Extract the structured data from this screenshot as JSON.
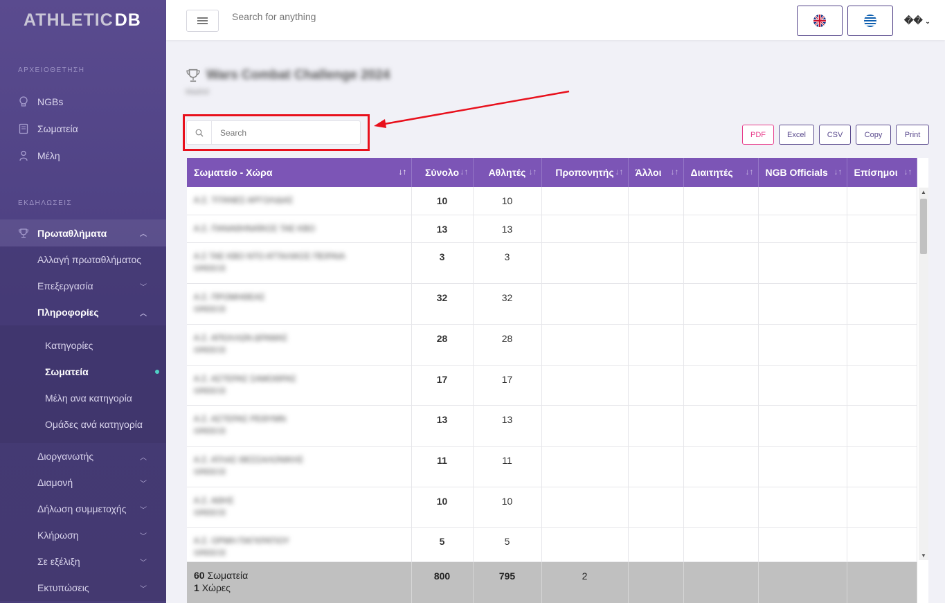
{
  "app": {
    "logo_main": "ATHLETIC",
    "logo_accent": "DB"
  },
  "sidebar": {
    "section_archive": "ΑΡΧΕΙΟΘΕΤΗΣΗ",
    "archive_items": [
      {
        "label": "NGBs",
        "icon": "lightbulb-icon"
      },
      {
        "label": "Σωματεία",
        "icon": "book-icon"
      },
      {
        "label": "Μέλη",
        "icon": "user-icon"
      }
    ],
    "section_events": "ΕΚΔΗΛΩΣΕΙΣ",
    "championships_label": "Πρωταθλήματα",
    "change_championship": "Αλλαγή πρωταθλήματος",
    "edit_label": "Επεξεργασία",
    "info_label": "Πληροφορίες",
    "info_items": [
      "Κατηγορίες",
      "Σωματεία",
      "Μέλη ανα κατηγορία",
      "Ομάδες ανά κατηγορία"
    ],
    "more_items": [
      "Διοργανωτής",
      "Διαμονή",
      "Δήλωση συμμετοχής",
      "Κλήρωση",
      "Σε εξέλιξη",
      "Εκτυπώσεις"
    ]
  },
  "topbar": {
    "search_placeholder": "Search for anything",
    "user_label": "��"
  },
  "page": {
    "title": "Wars Combat Challenge 2024",
    "subtitle": "Madrid"
  },
  "search": {
    "placeholder": "Search"
  },
  "export": {
    "pdf": "PDF",
    "excel": "Excel",
    "csv": "CSV",
    "copy": "Copy",
    "print": "Print"
  },
  "table": {
    "headers": [
      "Σωματείο - Χώρα",
      "Σύνολο",
      "Αθλητές",
      "Προπονητής",
      "Άλλοι",
      "Διαιτητές",
      "NGB Officials",
      "Επίσημοι"
    ],
    "rows": [
      {
        "club": "Α.Σ. ΤΙΤΑΝΕΣ ΑΡΓΟΛΙΔΑΣ",
        "country": "",
        "total": "10",
        "athletes": "10"
      },
      {
        "club": "Α.Σ. ΠΑΝΑΘΗΝΑΪΚΟΣ ΤΑΕ ΚΒΟ",
        "country": "",
        "total": "13",
        "athletes": "13"
      },
      {
        "club": "Α.Σ ΤΑΕ ΚΒΟ ΝΤΟ ΑΤΤΑΛΙΚΟΣ ΠΕΙΡΑΙΑ",
        "country": "GREECE",
        "total": "3",
        "athletes": "3"
      },
      {
        "club": "Α.Σ. ΠΡΟΜΗΘΕΑΣ",
        "country": "GREECE",
        "total": "32",
        "athletes": "32"
      },
      {
        "club": "Α.Σ. ΑΠΟΛΛΩΝ ΔΡΑΜΑΣ",
        "country": "GREECE",
        "total": "28",
        "athletes": "28"
      },
      {
        "club": "Α.Σ. ΑΣΤΕΡΑΣ ΣΑΜΟΘΡΑΣ",
        "country": "GREECE",
        "total": "17",
        "athletes": "17"
      },
      {
        "club": "Α.Σ. ΑΣΤΕΡΑΣ ΡΕΘΥΜΝ",
        "country": "GREECE",
        "total": "13",
        "athletes": "13"
      },
      {
        "club": "Α.Σ. ΑΤΛΑΣ ΘΕΣΣΑΛΟΝΙΚΗΣ",
        "country": "GREECE",
        "total": "11",
        "athletes": "11"
      },
      {
        "club": "Α.Σ. ΑΘΗΣ",
        "country": "GREECE",
        "total": "10",
        "athletes": "10"
      },
      {
        "club": "Α.Σ. ΟΡΜΗ ΠΑΓΚΡΑΤΙΟΥ",
        "country": "GREECE",
        "total": "5",
        "athletes": "5"
      }
    ],
    "footer": {
      "clubs_count": "60",
      "clubs_label": "Σωματεία",
      "countries_count": "1",
      "countries_label": "Χώρες",
      "total": "800",
      "athletes": "795",
      "coaches": "2"
    }
  },
  "colors": {
    "accent": "#7c55b6",
    "sidebar": "#4b3f80",
    "highlight": "#e8101c"
  }
}
